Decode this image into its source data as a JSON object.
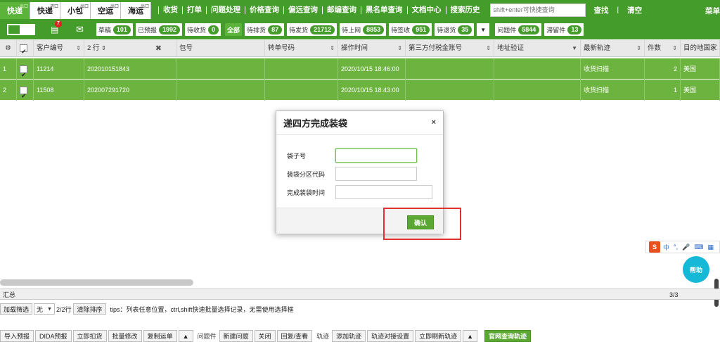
{
  "topbar": {
    "modes": [
      {
        "label": "快递",
        "sup": "出口",
        "active": true
      },
      {
        "label": "快递",
        "sup": "进口",
        "active": false
      },
      {
        "label": "小包",
        "sup": "出口",
        "active": false
      },
      {
        "label": "空运",
        "sup": "出口",
        "active": false
      },
      {
        "label": "海运",
        "sup": "出口",
        "active": false
      }
    ],
    "menu": [
      "收货",
      "打单",
      "问题处理",
      "价格查询",
      "偏远查询",
      "邮编查询",
      "黑名单查询",
      "文档中心",
      "搜索历史"
    ],
    "search_placeholder": "shift+enter可快捷查询",
    "search_button": "查找",
    "clear_button": "清空",
    "menu_right": "菜单"
  },
  "statusbar": {
    "doc_badge": "7",
    "pills_left": [
      {
        "label": "草稿",
        "count": "101"
      },
      {
        "label": "已预报",
        "count": "1992"
      },
      {
        "label": "待收货",
        "count": "0"
      }
    ],
    "all_label": "全部",
    "pills_right": [
      {
        "label": "待排货",
        "count": "87"
      },
      {
        "label": "待发货",
        "count": "21712"
      },
      {
        "label": "待上网",
        "count": "8853"
      },
      {
        "label": "待签收",
        "count": "951"
      },
      {
        "label": "待退货",
        "count": "35"
      }
    ],
    "dropdown_icon": "▼",
    "pills_extra": [
      {
        "label": "问题件",
        "count": "5844"
      },
      {
        "label": "滞留件",
        "count": "13"
      }
    ]
  },
  "grid": {
    "headers": {
      "customer_no": "客户编号",
      "rows_count": "2 行",
      "bag_no": "包号",
      "transfer_no": "转单号码",
      "op_time": "操作时间",
      "tax_account": "第三方付税金账号",
      "address_verify": "地址验证",
      "latest_track": "最新轨迹",
      "pieces": "件数",
      "dest_country": "目的地国家"
    },
    "rows": [
      {
        "idx": "1",
        "customer_no": "11214",
        "order_no": "202010151843",
        "op_time": "2020/10/15 18:46:00",
        "latest_track": "收货扫描",
        "pieces": "2",
        "dest_country": "美国"
      },
      {
        "idx": "2",
        "customer_no": "11508",
        "order_no": "202007291720",
        "op_time": "2020/10/15 18:43:00",
        "latest_track": "收货扫描",
        "pieces": "1",
        "dest_country": "美国"
      }
    ]
  },
  "dialog": {
    "title": "递四方完成装袋",
    "close": "×",
    "field1_label": "袋子号",
    "field2_label": "装袋分区代码",
    "field3_label": "完成装袋时间",
    "confirm": "确认"
  },
  "summary": {
    "label": "汇总",
    "page": "3/3"
  },
  "filterbar": {
    "load_filter": "加载筛选",
    "none": "无",
    "rows": "2/2行",
    "clear_sort": "清除排序",
    "tips": "tips：列表任意位置，ctrl,shift快速批量选择记录，无需使用选择框"
  },
  "bottombar": {
    "buttons_a": [
      "导入预报",
      "DIDA预报",
      "立即扣货",
      "批量修改",
      "复制运单"
    ],
    "label_problem": "问题件",
    "buttons_b": [
      "新建问题",
      "关闭",
      "回复/查看"
    ],
    "label_track": "轨迹",
    "buttons_c": [
      "添加轨迹",
      "轨迹对接设置",
      "立即刷新轨迹"
    ],
    "official_track": "官网查询轨迹"
  },
  "ime": {
    "zh": "中",
    "dot": "°,",
    "mic": "🎤",
    "kbd": "⌨",
    "grid": "▦"
  },
  "help": "帮助"
}
